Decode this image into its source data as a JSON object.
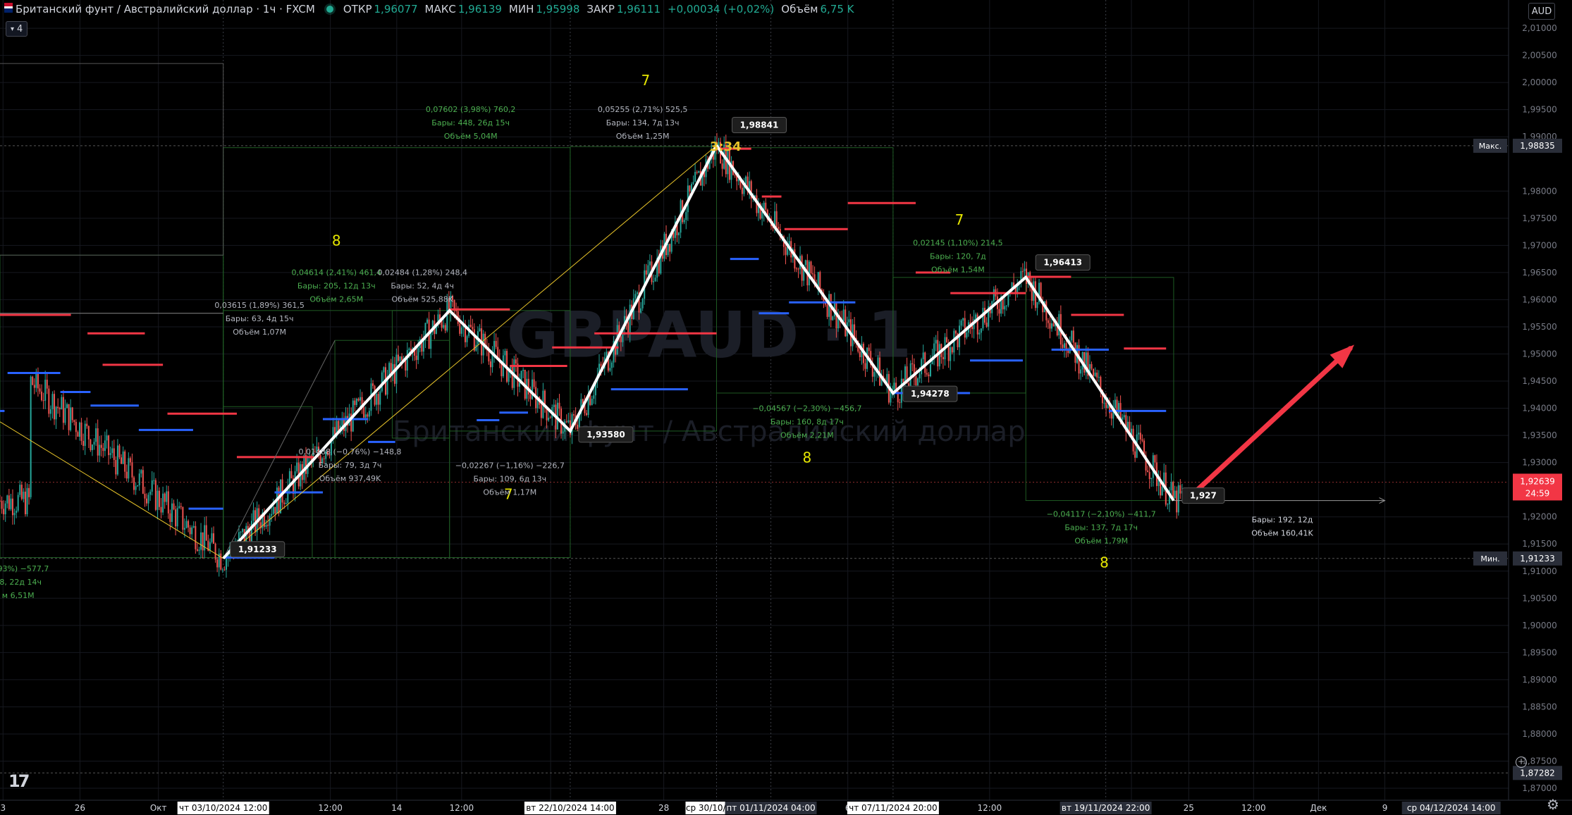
{
  "header": {
    "symbol_title": "Британский фунт / Австралийский доллар · 1ч · FXCM",
    "open_label": "ОТКР",
    "open_value": "1,96077",
    "high_label": "МАКС",
    "high_value": "1,96139",
    "low_label": "МИН",
    "low_value": "1,95998",
    "close_label": "ЗАКР",
    "close_value": "1,96111",
    "change_value": "+0,00034 (+0,02%)",
    "volume_label": "Объём",
    "volume_value": "6,75 K",
    "indicators_badge": "4",
    "currency_badge": "AUD"
  },
  "watermark": {
    "ticker": "GBPAUD · 1",
    "name": "Британский фунт / Австралийский доллар"
  },
  "chart_data": {
    "type": "line",
    "title": "Британский фунт / Австралийский доллар · 1ч · FXCM",
    "xlabel": "",
    "ylabel": "",
    "ylim": [
      1.8678,
      2.0152
    ],
    "grid": true,
    "y_ticks": [
      "2,01000",
      "2,00500",
      "2,00000",
      "1,99500",
      "1,99000",
      "1,98000",
      "1,97500",
      "1,97000",
      "1,96500",
      "1,96000",
      "1,95500",
      "1,95000",
      "1,94500",
      "1,94000",
      "1,93500",
      "1,93000",
      "1,92000",
      "1,91500",
      "1,91000",
      "1,90500",
      "1,90000",
      "1,89500",
      "1,89000",
      "1,88500",
      "1,88000",
      "1,87500",
      "1,87000"
    ],
    "x_ticks": [
      "3",
      "26",
      "Окт",
      "12:00",
      "14",
      "12:00",
      "12:00",
      "28",
      "6",
      "12:00",
      "18",
      "25",
      "12:00",
      "Дек",
      "9"
    ],
    "x_highlights": [
      "чт 03/10/2024  12:00",
      "вт 22/10/2024  14:00",
      "ср 30/10/2024",
      "пт 01/11/2024  04:00",
      "чт 07/11/2024  20:00",
      "вт 19/11/2024  22:00",
      "ср 04/12/2024  14:00"
    ],
    "price_badges": [
      {
        "label": "Макс.",
        "value": "1,98835",
        "kind": "max"
      },
      {
        "label": "",
        "value": "1,92639",
        "sub": "24:59",
        "kind": "last"
      },
      {
        "label": "Мин.",
        "value": "1,91233",
        "kind": "min"
      },
      {
        "label": "",
        "value": "1,87282",
        "kind": "cursor"
      }
    ],
    "zigzag": [
      {
        "t": 0.02,
        "price": 1.945
      },
      {
        "t": 0.148,
        "price": 1.91233
      },
      {
        "t": 0.298,
        "price": 1.958
      },
      {
        "t": 0.378,
        "price": 1.9358
      },
      {
        "t": 0.475,
        "price": 1.98841
      },
      {
        "t": 0.592,
        "price": 1.94278
      },
      {
        "t": 0.68,
        "price": 1.96413
      },
      {
        "t": 0.778,
        "price": 1.923
      }
    ],
    "point_labels": [
      "1,91233",
      "1,93580",
      "1,98841",
      "1,94278",
      "1,96413",
      "1,927"
    ],
    "wave_counts": [
      "8",
      "7",
      "7",
      "8",
      "7",
      "8",
      "7",
      "8"
    ],
    "measurements": [
      {
        "l1": "-2,93%) −577,7",
        "l2": "98, 22д 14ч",
        "l3": "м 6,51M"
      },
      {
        "l1": "0,03615 (1,89%) 361,5",
        "l2": "Бары: 63, 4д 15ч",
        "l3": "Объём 1,07M"
      },
      {
        "l1": "0,04614 (2,41%) 461,4",
        "l2": "Бары: 205, 12д 13ч",
        "l3": "Объём 2,65M"
      },
      {
        "l1": "0,02484 (1,28%) 248,4",
        "l2": "Бары: 52, 4д 4ч",
        "l3": "Объём 525,88K"
      },
      {
        "l1": "0,01488 (−0,76%) −148,8",
        "l2": "Бары: 79, 3д 7ч",
        "l3": "Объём 937,49K"
      },
      {
        "l1": "−0,02267 (−1,16%) −226,7",
        "l2": "Бары: 109, 6д 13ч",
        "l3": "Объём 1,17M"
      },
      {
        "l1": "0,07602 (3,98%) 760,2",
        "l2": "Бары: 448, 26д 15ч",
        "l3": "Объём 5,04M"
      },
      {
        "l1": "0,05255 (2,71%) 525,5",
        "l2": "Бары: 134, 7д 13ч",
        "l3": "Объём 1,25M"
      },
      {
        "l1": "−0,04567 (−2,30%) −456,7",
        "l2": "Бары: 160, 8д 17ч",
        "l3": "Объём 2,21M"
      },
      {
        "l1": "0,02145 (1,10%) 214,5",
        "l2": "Бары: 120, 7д",
        "l3": "Объём 1,54M"
      },
      {
        "l1": "−0,04117 (−2,10%) −411,7",
        "l2": "Бары: 137, 7д 17ч",
        "l3": "Объём 1,79M"
      },
      {
        "l1": "Бары: 192, 12д",
        "l2": "Объём 160,41K",
        "l3": ""
      }
    ],
    "time_label": "3:34",
    "colors": {
      "bull": "#26a69a",
      "bear": "#ef5350",
      "zigzag": "#ffffff",
      "resistance": "#f23645",
      "support": "#2962ff",
      "trend": "#e6c229",
      "measure": "#4caf50",
      "arrow": "#f23645",
      "count": "#e6e600"
    }
  }
}
